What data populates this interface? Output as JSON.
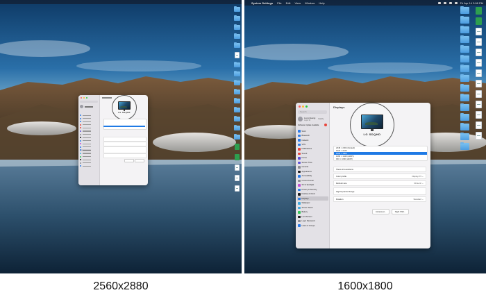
{
  "captions": {
    "left": "2560x2880",
    "right": "1600x1800"
  },
  "left_screen": {
    "window": {
      "monitor_name": "LG SDQHD"
    }
  },
  "right_screen": {
    "menubar": {
      "app_name": "System Settings",
      "menus": [
        "File",
        "Edit",
        "View",
        "Window",
        "Help"
      ],
      "clock": "Fri Apr 14 3:08 PM"
    },
    "window": {
      "title": "Displays",
      "search_placeholder": "Search",
      "profile": {
        "name": "Long Huang",
        "subtitle": "Apple ID",
        "family": "Family"
      },
      "update_notice": "Software Update Available",
      "sidebar_items": [
        {
          "label": "Wi-Fi",
          "color": "#2a7bea"
        },
        {
          "label": "Bluetooth",
          "color": "#2a7bea"
        },
        {
          "label": "Network",
          "color": "#2a7bea"
        },
        {
          "label": "VPN",
          "color": "#2a7bea"
        },
        {
          "label": "Notifications",
          "color": "#e8453c"
        },
        {
          "label": "Sound",
          "color": "#e8453c"
        },
        {
          "label": "Focus",
          "color": "#5b4fd8"
        },
        {
          "label": "Screen Time",
          "color": "#5b4fd8"
        },
        {
          "label": "General",
          "color": "#8e8e93"
        },
        {
          "label": "Appearance",
          "color": "#1c1c1e"
        },
        {
          "label": "Accessibility",
          "color": "#2a7bea"
        },
        {
          "label": "Control Center",
          "color": "#8e8e93"
        },
        {
          "label": "Siri & Spotlight",
          "color": "#c34fd6"
        },
        {
          "label": "Privacy & Security",
          "color": "#2a7bea"
        },
        {
          "label": "Desktop & Dock",
          "color": "#1c1c1e"
        },
        {
          "label": "Displays",
          "color": "#2a7bea",
          "selected": true
        },
        {
          "label": "Wallpaper",
          "color": "#3fa9e0"
        },
        {
          "label": "Screen Saver",
          "color": "#3fa9e0"
        },
        {
          "label": "Battery",
          "color": "#34c759"
        },
        {
          "label": "Lock Screen",
          "color": "#1c1c1e"
        },
        {
          "label": "Login Password",
          "color": "#8e8e93"
        },
        {
          "label": "Users & Groups",
          "color": "#2a7bea"
        }
      ],
      "monitor_name": "LG SDQHD",
      "resolutions": [
        {
          "label": "2048 × 2304 (Default)"
        },
        {
          "label": "1920 × 2160"
        },
        {
          "label": "1600 × 1800",
          "selected": true
        },
        {
          "label": "1280 × 1440 (HiDPI)"
        },
        {
          "label": "960 × 1080 (HiDPI)"
        }
      ],
      "settings": [
        {
          "label": "Show all resolutions",
          "value": ""
        },
        {
          "label": "Color profile",
          "value": "Display P3 ⌄"
        },
        {
          "label": "Refresh rate",
          "value": "60 Hertz ⌄"
        },
        {
          "label": "High Dynamic Range",
          "value": ""
        },
        {
          "label": "Rotation",
          "value": "Standard ⌄"
        }
      ],
      "buttons": {
        "advanced": "Advanced...",
        "night_shift": "Night Shift..."
      }
    }
  },
  "colors": {
    "accent": "#1f7ae5",
    "close": "#ff5f57",
    "minimize": "#febc2e",
    "zoom": "#28c840"
  }
}
